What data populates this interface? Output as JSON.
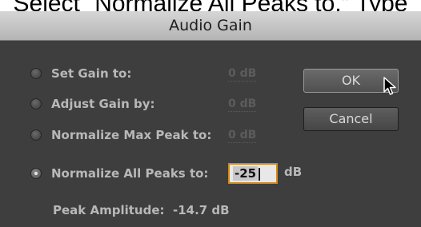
{
  "caption": "Select “Normalize All Peaks to.” Type",
  "dialog": {
    "title": "Audio Gain",
    "options": [
      {
        "label": "Set Gain to:",
        "value": "0 dB",
        "selected": false
      },
      {
        "label": "Adjust Gain by:",
        "value": "0 dB",
        "selected": false
      },
      {
        "label": "Normalize Max Peak to:",
        "value": "0 dB",
        "selected": false
      },
      {
        "label": "Normalize All Peaks to:",
        "value": "-25",
        "unit": "dB",
        "selected": true
      }
    ],
    "peak_label": "Peak Amplitude:",
    "peak_value": "-14.7 dB",
    "ok_label": "OK",
    "cancel_label": "Cancel"
  },
  "colors": {
    "background": "#3e3e3e",
    "input_focus": "#d08a20"
  },
  "icons": [
    "radio-icon",
    "mouse-pointer-icon"
  ]
}
